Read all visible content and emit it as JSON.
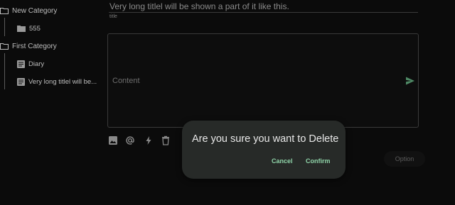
{
  "sidebar": {
    "categories": [
      {
        "label": "New Category",
        "children": [
          {
            "label": "555",
            "icon": "folder-icon"
          }
        ]
      },
      {
        "label": "First Category",
        "children": [
          {
            "label": "Diary",
            "icon": "note-icon"
          },
          {
            "label": "Very long titlel will be...",
            "icon": "note-icon"
          }
        ]
      }
    ]
  },
  "editor": {
    "title_value": "Very long titlel will be shown a part of it like this.",
    "title_caption": "title",
    "content_placeholder": "Content",
    "option_label": "Option"
  },
  "dialog": {
    "message": "Are you sure you want to Delete",
    "cancel_label": "Cancel",
    "confirm_label": "Confirm"
  },
  "colors": {
    "background": "#0b0b0b",
    "dialog_bg": "#272a28",
    "accent_green": "#8fd3a8"
  }
}
